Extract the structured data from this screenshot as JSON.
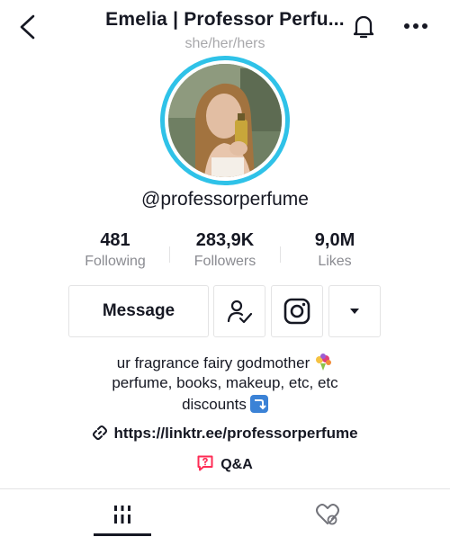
{
  "header": {
    "title": "Emelia | Professor Perfu...",
    "pronouns": "she/her/hers",
    "back_icon": "chevron-left-icon",
    "bell_icon": "bell-icon",
    "more_icon": "more-horizontal-icon"
  },
  "profile": {
    "handle": "@professorperfume",
    "avatar_ring_color": "#2fc2e8"
  },
  "stats": [
    {
      "value": "481",
      "label": "Following"
    },
    {
      "value": "283,9K",
      "label": "Followers"
    },
    {
      "value": "9,0M",
      "label": "Likes"
    }
  ],
  "actions": {
    "message_label": "Message",
    "follow_icon": "user-check-icon",
    "instagram_icon": "instagram-icon",
    "dropdown_icon": "caret-down-icon"
  },
  "bio": {
    "line1": "ur fragrance fairy godmother",
    "line2": "perfume, books, makeup, etc, etc",
    "line3": "discounts",
    "link": "https://linktr.ee/professorperfume",
    "qa_label": "Q&A",
    "qa_color": "#fe2c55"
  },
  "tabs": [
    {
      "icon": "grid-videos-icon",
      "active": true
    },
    {
      "icon": "liked-heart-icon",
      "active": false
    }
  ]
}
